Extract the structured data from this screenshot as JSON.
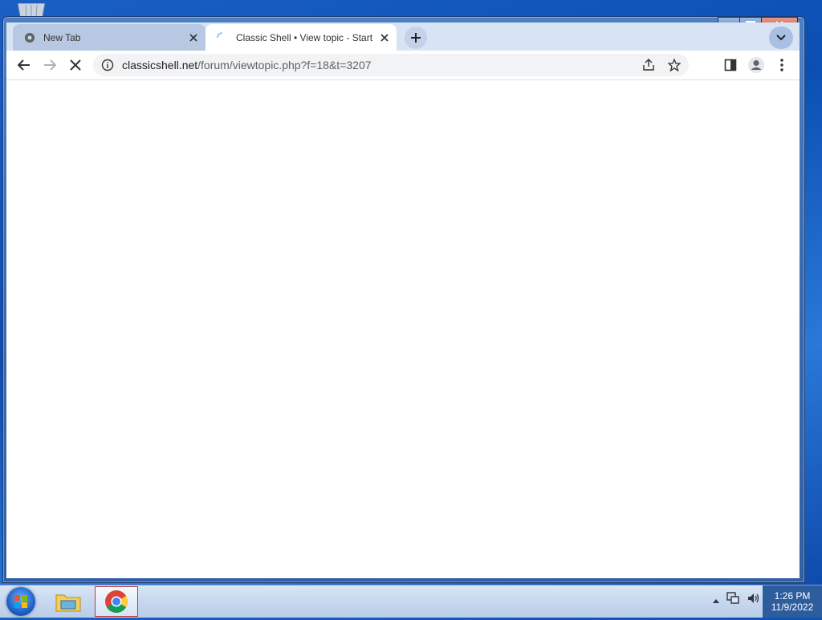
{
  "browser": {
    "tabs": [
      {
        "title": "New Tab",
        "loading": false,
        "active": false
      },
      {
        "title": "Classic Shell • View topic - Start M",
        "loading": true,
        "active": true
      }
    ],
    "omnibox": {
      "host": "classicshell.net",
      "path": "/forum/viewtopic.php?f=18&t=3207"
    }
  },
  "taskbar": {
    "clock_time": "1:26 PM",
    "clock_date": "11/9/2022"
  },
  "colors": {
    "desktop": "#1a5fc4",
    "tab_active": "#ffffff",
    "tab_inactive": "#b7c8e3",
    "tabstrip": "#d8e3f3"
  }
}
